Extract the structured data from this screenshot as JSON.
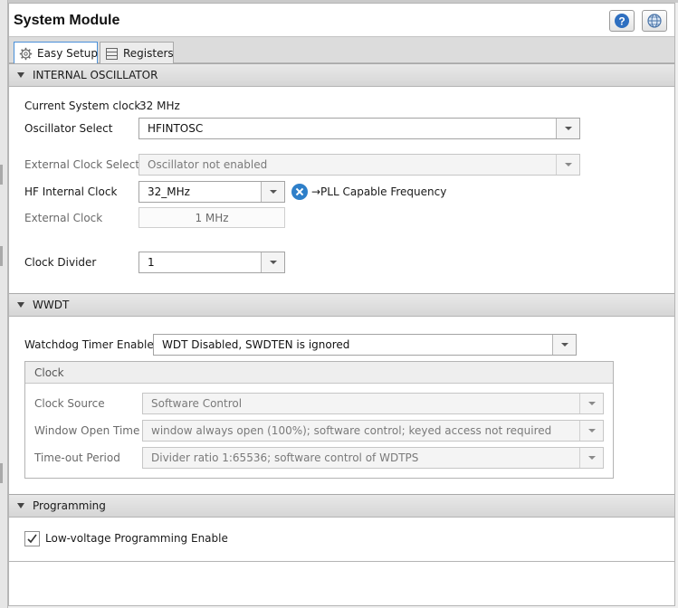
{
  "window": {
    "title": "System Module"
  },
  "header_icons": {
    "help": "help-icon",
    "globe": "globe-icon"
  },
  "tabs": [
    {
      "label": "Easy Setup",
      "icon": "gear-icon",
      "active": true
    },
    {
      "label": "Registers",
      "icon": "list-icon",
      "active": false
    }
  ],
  "internal_oscillator": {
    "section_title": "INTERNAL OSCILLATOR",
    "current_clock_label": "Current System clock",
    "current_clock_value": "32 MHz",
    "oscillator_select_label": "Oscillator Select",
    "oscillator_select_value": "HFINTOSC",
    "external_clock_select_label": "External Clock Select",
    "external_clock_select_value": "Oscillator not enabled",
    "hf_internal_clock_label": "HF Internal Clock",
    "hf_internal_clock_value": "32_MHz",
    "pll_note": "→PLL Capable Frequency",
    "external_clock_label": "External Clock",
    "external_clock_value": "1 MHz",
    "clock_divider_label": "Clock Divider",
    "clock_divider_value": "1"
  },
  "wwdt": {
    "section_title": "WWDT",
    "watchdog_enable_label": "Watchdog Timer Enable",
    "watchdog_enable_value": "WDT Disabled, SWDTEN is ignored",
    "clock_group": {
      "title": "Clock",
      "clock_source_label": "Clock Source",
      "clock_source_value": "Software Control",
      "window_open_time_label": "Window Open Time",
      "window_open_time_value": "window always open (100%); software control; keyed access not required",
      "timeout_period_label": "Time-out Period",
      "timeout_period_value": "Divider ratio 1:65536; software control of WDTPS"
    }
  },
  "programming": {
    "section_title": "Programming",
    "lvp_label": "Low-voltage Programming Enable",
    "lvp_checked": true
  },
  "colors": {
    "accent": "#2e7fc9",
    "active_tab_border": "#4a90d9"
  }
}
